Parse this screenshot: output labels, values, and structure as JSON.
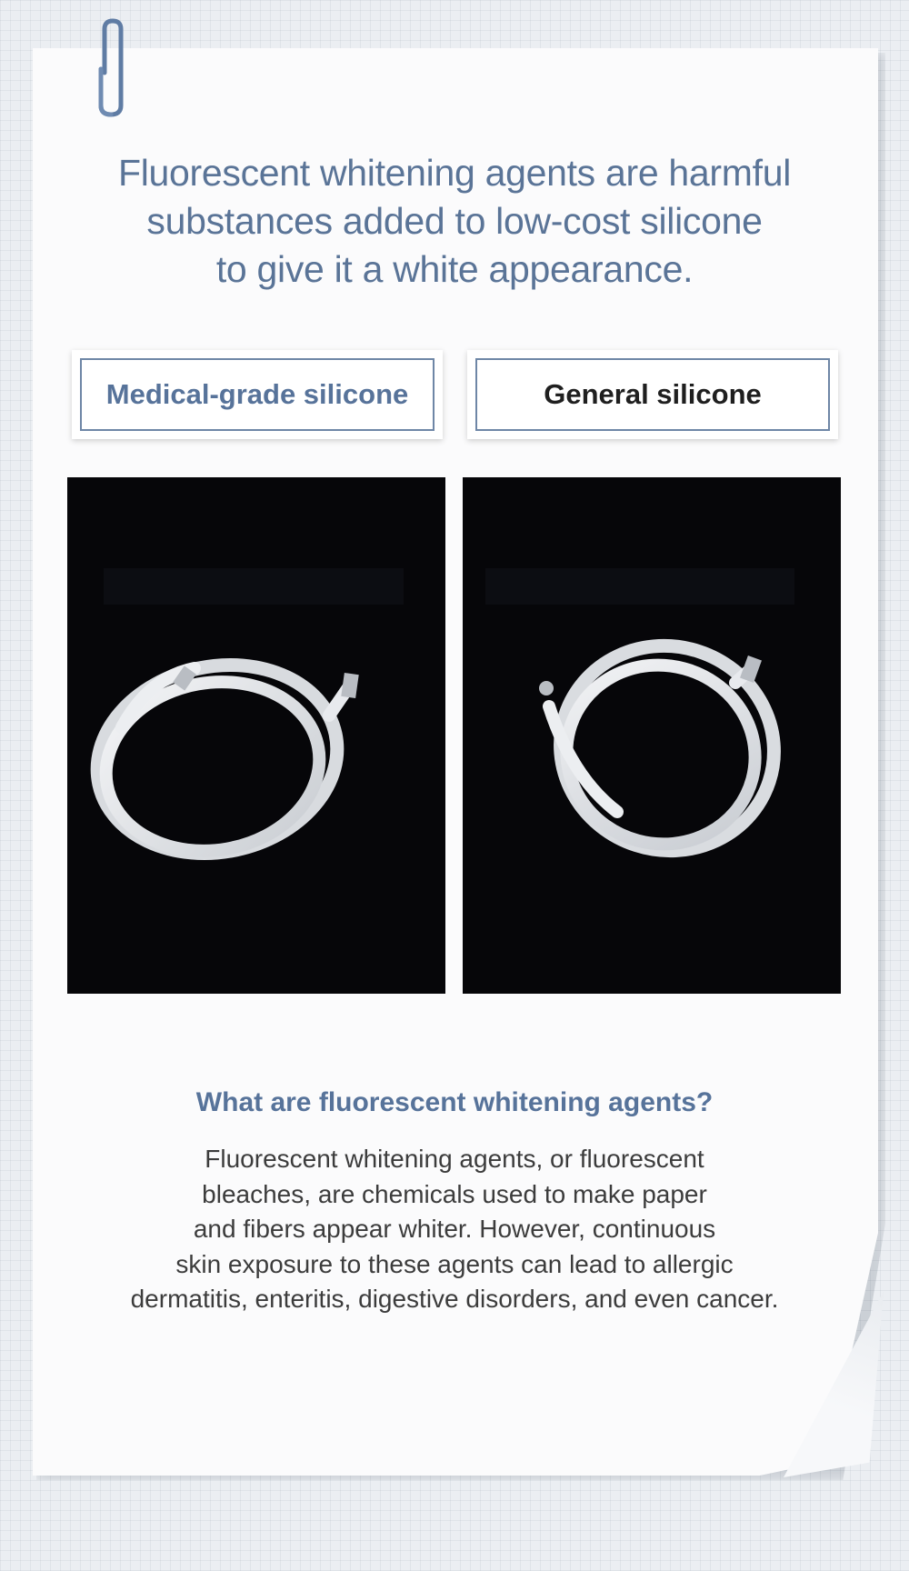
{
  "headline": {
    "line1": "Fluorescent whitening agents are harmful",
    "line2": "substances added to low-cost silicone",
    "line3": "to give it a white appearance."
  },
  "comparison": {
    "left_label": "Medical-grade silicone",
    "right_label": "General silicone"
  },
  "explanation": {
    "question": "What are fluorescent whitening agents?",
    "lines": [
      "Fluorescent whitening agents, or fluorescent",
      "bleaches, are chemicals used to make paper",
      "and fibers appear whiter. However, continuous",
      "skin exposure to these agents can lead to allergic",
      "dermatitis, enteritis, digestive disorders, and even cancer."
    ]
  },
  "colors": {
    "accent": "#57739a",
    "photo_background": "#060609",
    "paper": "#fbfbfc"
  },
  "icons": {
    "clip": "paperclip-icon"
  }
}
